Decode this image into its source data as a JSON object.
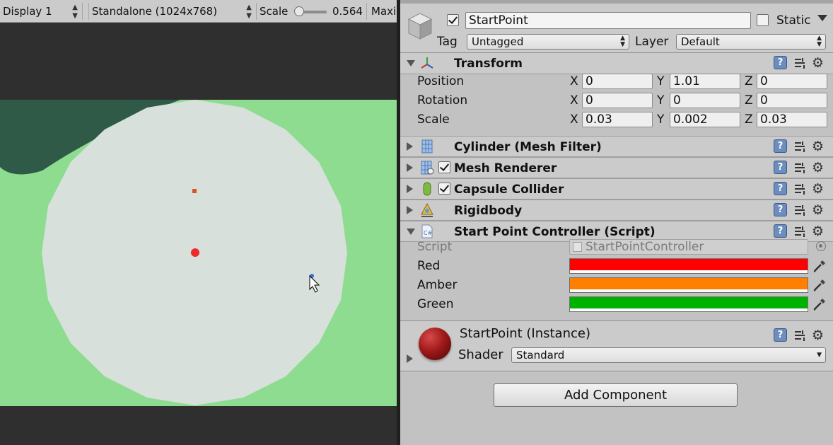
{
  "game_toolbar": {
    "display": "Display 1",
    "resolution": "Standalone (1024x768)",
    "scale_label": "Scale",
    "scale_value": "0.564",
    "maximize": "Maximize On Play"
  },
  "scene": {
    "ground_color": "#8ddc8f",
    "platform_color": "#d8e0dc",
    "shadow_color": "#2f5a48",
    "center_marker_color": "#ef2a2a"
  },
  "gameobject": {
    "active": true,
    "name": "StartPoint",
    "static_label": "Static",
    "static_checked": false,
    "tag_label": "Tag",
    "tag_value": "Untagged",
    "layer_label": "Layer",
    "layer_value": "Default"
  },
  "transform": {
    "title": "Transform",
    "rows": [
      {
        "label": "Position",
        "x": "0",
        "y": "1.01",
        "z": "0"
      },
      {
        "label": "Rotation",
        "x": "0",
        "y": "0",
        "z": "0"
      },
      {
        "label": "Scale",
        "x": "0.03",
        "y": "0.002",
        "z": "0.03"
      }
    ],
    "axis_x": "X",
    "axis_y": "Y",
    "axis_z": "Z"
  },
  "components": [
    {
      "title": "Cylinder (Mesh Filter)",
      "icon": "mesh-filter-icon"
    },
    {
      "title": "Mesh Renderer",
      "icon": "mesh-renderer-icon",
      "enabled": true
    },
    {
      "title": "Capsule Collider",
      "icon": "capsule-collider-icon",
      "enabled": true
    },
    {
      "title": "Rigidbody",
      "icon": "rigidbody-icon"
    }
  ],
  "script_component": {
    "title": "Start Point Controller (Script)",
    "script_label": "Script",
    "script_value": "StartPointController",
    "fields": [
      {
        "label": "Red",
        "color": "#ff0000"
      },
      {
        "label": "Amber",
        "color": "#ff7f00"
      },
      {
        "label": "Green",
        "color": "#00b200"
      }
    ]
  },
  "material": {
    "name": "StartPoint (Instance)",
    "shader_label": "Shader",
    "shader_value": "Standard"
  },
  "add_component": "Add Component"
}
